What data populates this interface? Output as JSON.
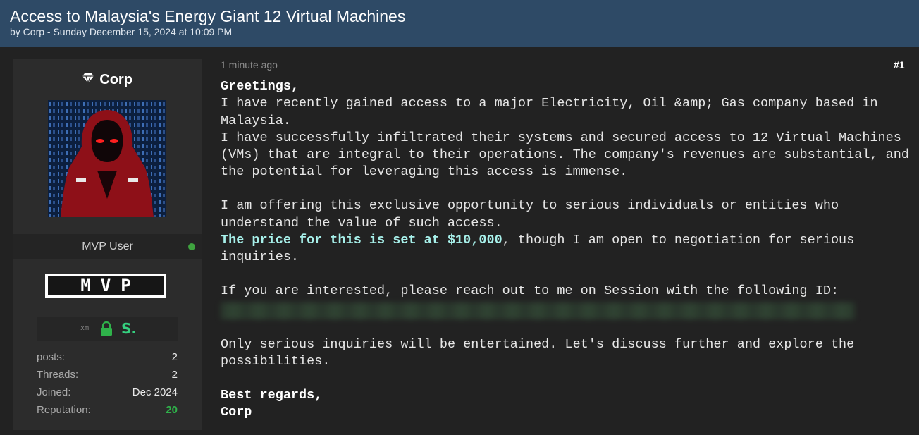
{
  "thread": {
    "title": "Access to Malaysia's Energy Giant 12 Virtual Machines",
    "meta": "by Corp - Sunday December 15, 2024 at 10:09 PM"
  },
  "author": {
    "username": "Corp",
    "username_icon": "gem-icon",
    "role": "MVP User",
    "online": true,
    "badge_text": "MVP",
    "awards": [
      {
        "name": "xm",
        "text": "xm"
      },
      {
        "name": "lock-icon"
      },
      {
        "name": "session-s-icon",
        "text": "S."
      }
    ],
    "stats": [
      {
        "label": "posts:",
        "value": "2"
      },
      {
        "label": "Threads:",
        "value": "2"
      },
      {
        "label": "Joined:",
        "value": "Dec 2024"
      },
      {
        "label": "Reputation:",
        "value": "20"
      }
    ]
  },
  "post": {
    "time": "1 minute ago",
    "number": "#1",
    "greeting": "Greetings,",
    "para1_line1": "I have recently gained access to a major Electricity, Oil &amp; Gas company based in Malaysia.",
    "para1_line2": "I have successfully infiltrated their systems and secured access to 12 Virtual Machines (VMs) that are integral to their operations. The company's revenues are substantial, and the potential for leveraging this access is immense.",
    "para2_line1": "I am offering this exclusive opportunity to serious individuals or entities who understand the value of such access.",
    "price_bold": "The price for this is set at $10,000",
    "price_rest": ", though I am open to negotiation for serious inquiries.",
    "para3": "If you are interested, please reach out to me on Session with the following ID:",
    "para4": "Only serious inquiries will be entertained. Let's discuss further and explore the possibilities.",
    "closing": "Best regards,",
    "signature": "Corp"
  },
  "colors": {
    "header_bg": "#2e4a66",
    "page_bg": "#222222",
    "sidebar_bg": "#2c2c2c",
    "reputation": "#2fb24a",
    "price_highlight": "#a7f0ea",
    "online": "#3fa33f"
  }
}
